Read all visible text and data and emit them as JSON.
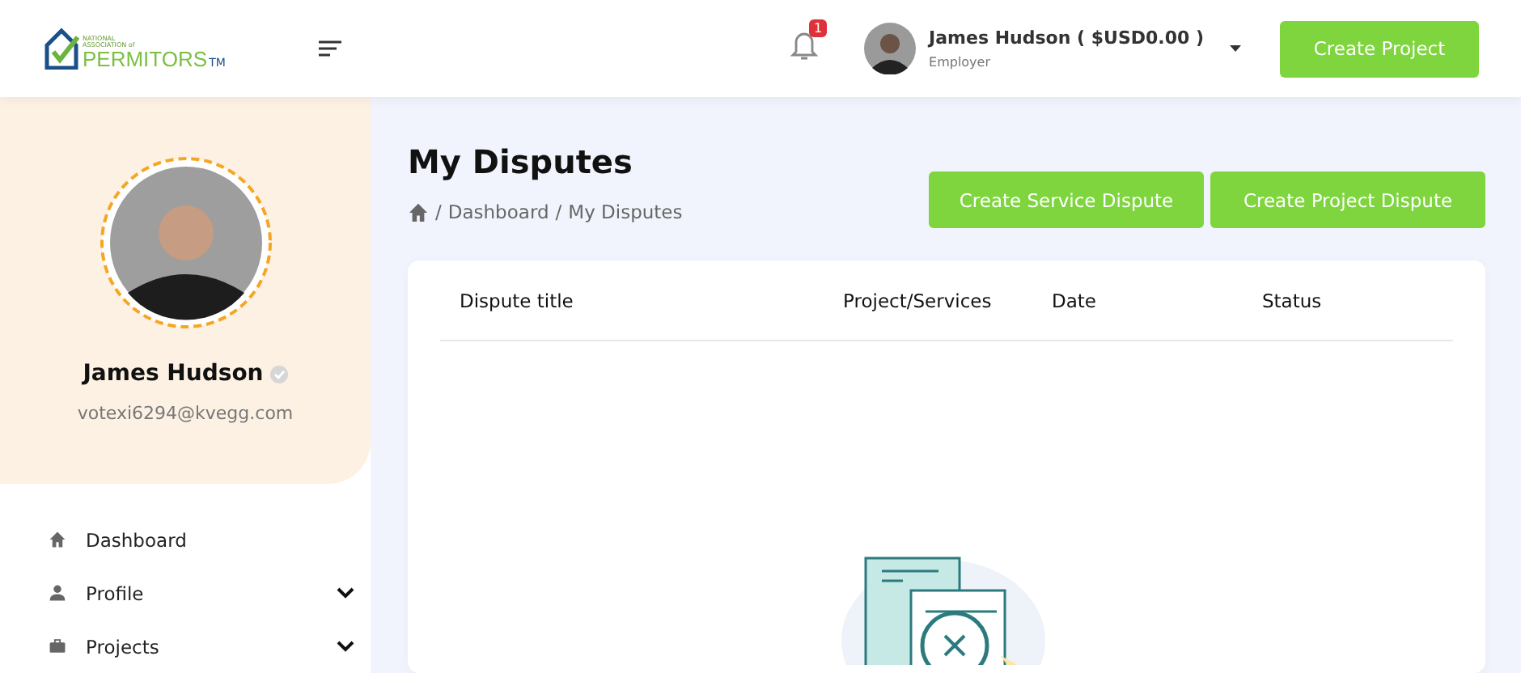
{
  "logo": {
    "small_text": "NATIONAL ASSOCIATION of",
    "name": "PERMITORS",
    "mark": "TM"
  },
  "header": {
    "notification_count": "1",
    "user_name": "James Hudson ( $USD0.00 )",
    "user_role": "Employer",
    "action_button": "Create Project"
  },
  "profile": {
    "name": "James Hudson",
    "verified": true,
    "email": "votexi6294@kvegg.com"
  },
  "sidebar": {
    "items": [
      {
        "label": "Dashboard",
        "kind": "home",
        "expandable": false
      },
      {
        "label": "Profile",
        "kind": "user",
        "expandable": true
      },
      {
        "label": "Projects",
        "kind": "briefcase",
        "expandable": true
      }
    ]
  },
  "page": {
    "title": "My Disputes",
    "breadcrumb_separator": "/",
    "breadcrumb": [
      "Dashboard",
      "My Disputes"
    ],
    "buttons": [
      "Create Service Dispute",
      "Create Project Dispute"
    ]
  },
  "table": {
    "columns": [
      "Dispute title",
      "Project/Services",
      "Date",
      "Status"
    ]
  }
}
